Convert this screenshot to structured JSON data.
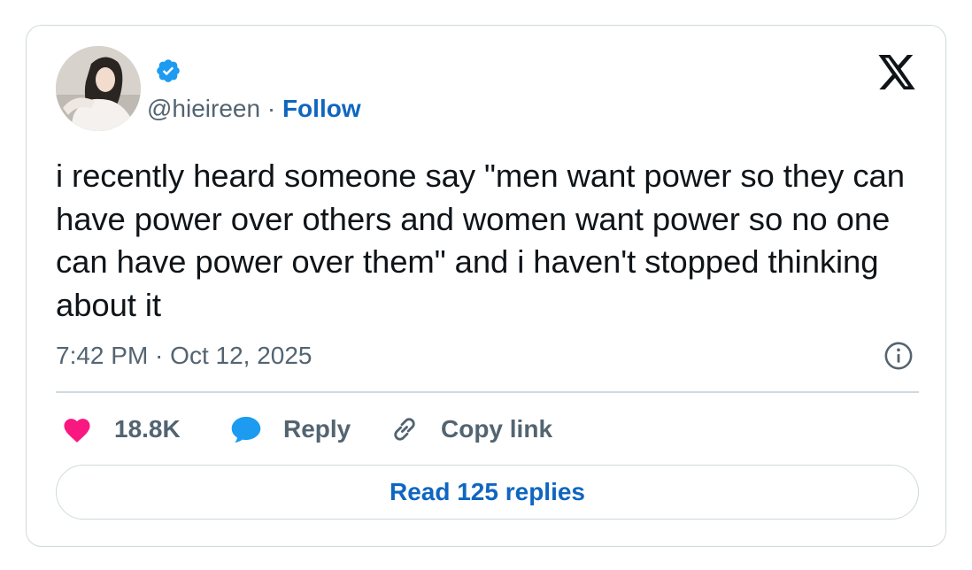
{
  "tweet": {
    "handle": "@hieireen",
    "separator": "·",
    "follow_label": "Follow",
    "text": "i recently heard someone say \"men want power so they can have power over others and women want power so no one can have power over them\" and i haven't stopped thinking about it",
    "timestamp": "7:42 PM · Oct 12, 2025"
  },
  "actions": {
    "like_count": "18.8K",
    "reply_label": "Reply",
    "copy_label": "Copy link"
  },
  "read_replies_label": "Read 125 replies",
  "icons": {
    "verified": "verified-badge-icon",
    "brand": "x-logo-icon",
    "info": "info-icon",
    "like": "heart-icon",
    "reply": "speech-bubble-icon",
    "copy": "link-icon"
  },
  "colors": {
    "accent_blue": "#0f66c0",
    "verified_blue": "#1d9bf0",
    "heart_pink": "#f91880",
    "muted_text": "#536471",
    "border": "#cfd9de"
  }
}
